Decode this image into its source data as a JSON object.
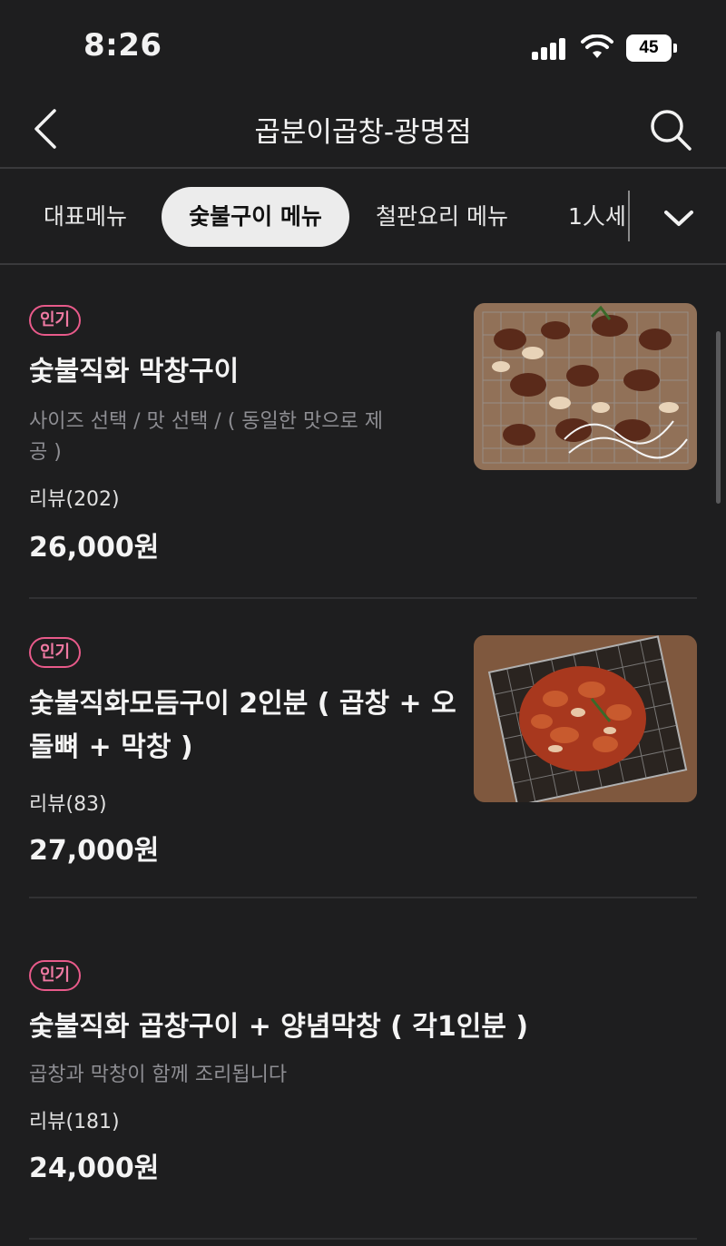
{
  "status": {
    "time": "8:26",
    "battery": "45"
  },
  "header": {
    "title": "곱분이곱창-광명점"
  },
  "tabs": [
    {
      "label": "대표메뉴"
    },
    {
      "label": "숯불구이 메뉴"
    },
    {
      "label": "철판요리 메뉴"
    },
    {
      "label": "1人세"
    }
  ],
  "items": [
    {
      "badge": "인기",
      "name": "숯불직화 막창구이",
      "desc_line1": "사이즈 선택  /  맛 선택 / ( 동일한 맛으로 제",
      "desc_line2": "공 )",
      "review": "리뷰(202)",
      "price": "26,000원"
    },
    {
      "badge": "인기",
      "name_line1": "숯불직화모듬구이 2인분 ( 곱창 + 오",
      "name_line2": "돌뼈 + 막창 )",
      "review": "리뷰(83)",
      "price": "27,000원"
    },
    {
      "badge": "인기",
      "name": "숯불직화 곱창구이 + 양념막창 ( 각1인분 )",
      "desc": "곱창과 막창이 함께 조리됩니다",
      "review": "리뷰(181)",
      "price": "24,000원"
    }
  ]
}
